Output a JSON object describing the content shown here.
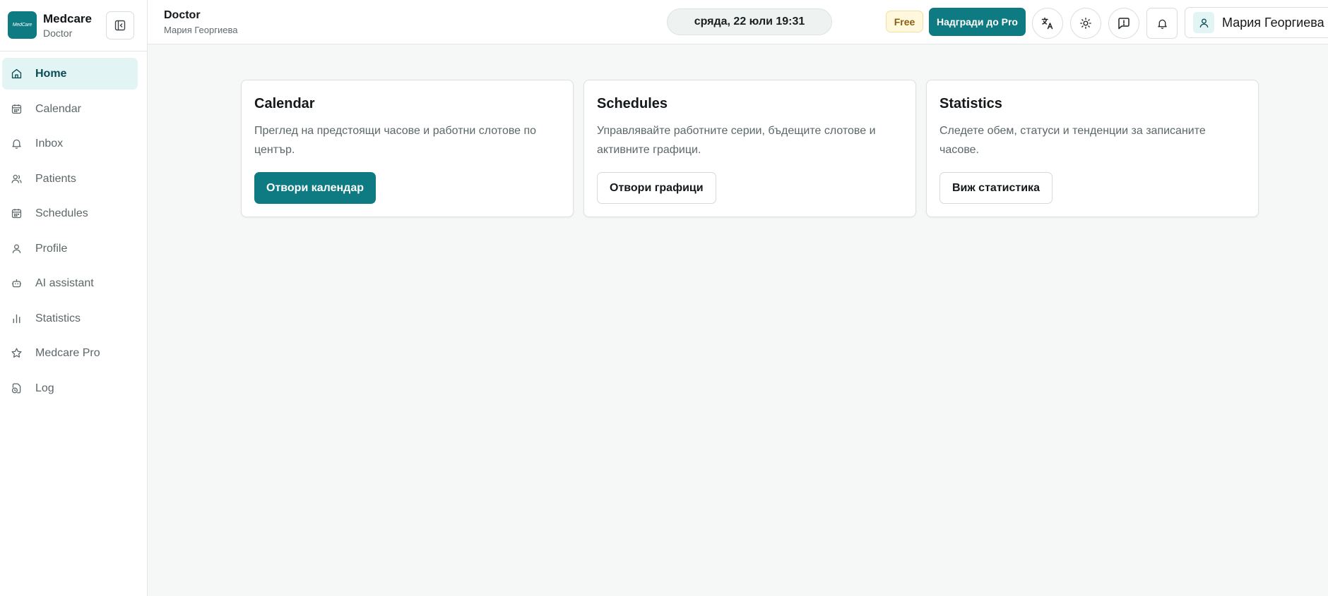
{
  "brand": {
    "logo_text": "MedCare",
    "name": "Medcare",
    "role": "Doctor"
  },
  "sidebar": {
    "items": [
      {
        "label": "Home",
        "icon": "home-icon",
        "active": true
      },
      {
        "label": "Calendar",
        "icon": "calendar-icon",
        "active": false
      },
      {
        "label": "Inbox",
        "icon": "bell-icon",
        "active": false
      },
      {
        "label": "Patients",
        "icon": "users-icon",
        "active": false
      },
      {
        "label": "Schedules",
        "icon": "calendar-icon",
        "active": false
      },
      {
        "label": "Profile",
        "icon": "user-icon",
        "active": false
      },
      {
        "label": "AI assistant",
        "icon": "bot-icon",
        "active": false
      },
      {
        "label": "Statistics",
        "icon": "bar-chart-icon",
        "active": false
      },
      {
        "label": "Medcare Pro",
        "icon": "star-icon",
        "active": false
      },
      {
        "label": "Log",
        "icon": "log-icon",
        "active": false
      }
    ]
  },
  "header": {
    "title": "Doctor",
    "subtitle": "Мария Георгиева",
    "datetime": "сряда, 22 юли 19:31",
    "plan_badge": "Free",
    "upgrade_label": "Надгради до Pro",
    "user_name": "Мария Георгиева"
  },
  "cards": [
    {
      "title": "Calendar",
      "description": "Преглед на предстоящи часове и работни слотове по център.",
      "button": "Отвори календар"
    },
    {
      "title": "Schedules",
      "description": "Управлявайте работните серии, бъдещите слотове и активните графици.",
      "button": "Отвори графици"
    },
    {
      "title": "Statistics",
      "description": "Следете обем, статуси и тенденции за записаните часове.",
      "button": "Виж статистика"
    }
  ],
  "colors": {
    "accent": "#0e7a82",
    "active_nav_bg": "#e2f4f3",
    "free_badge_bg": "#fff8dd",
    "page_bg": "#f6f7f7"
  }
}
